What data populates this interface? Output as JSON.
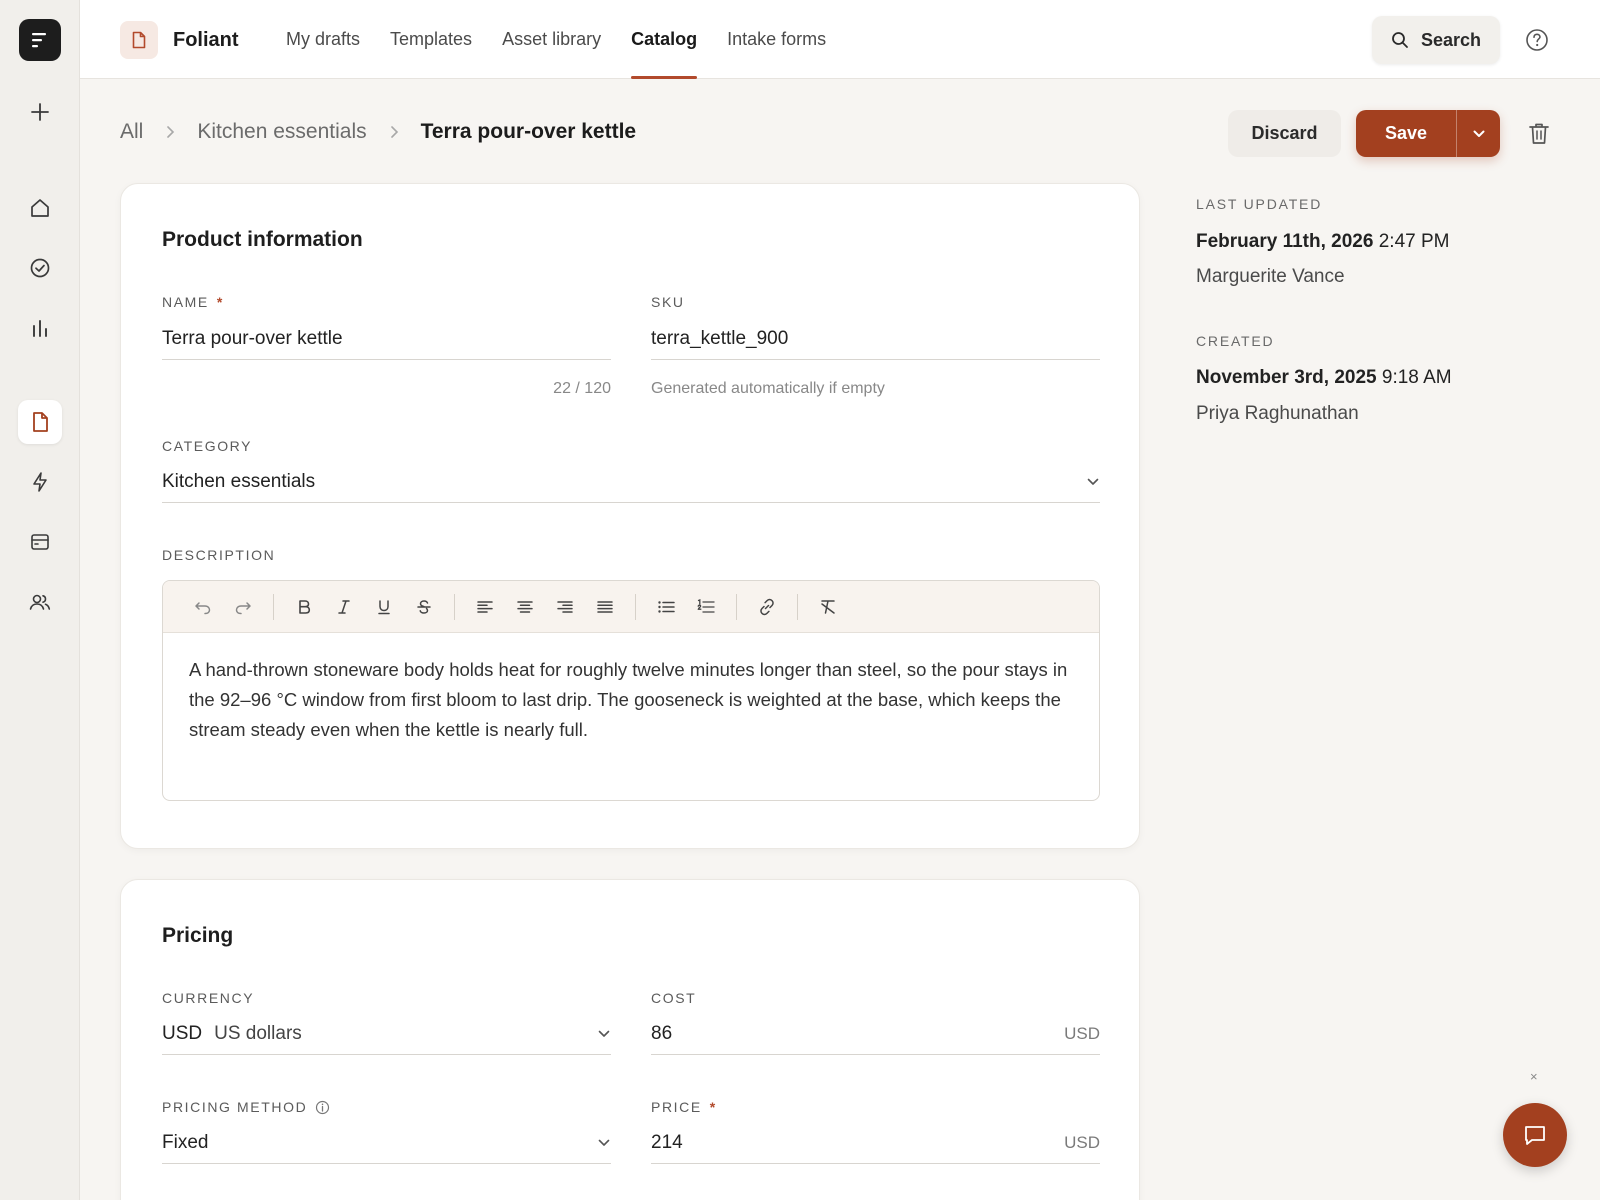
{
  "app": {
    "brand": "Foliant"
  },
  "nav": {
    "tabs": [
      {
        "label": "My drafts"
      },
      {
        "label": "Templates"
      },
      {
        "label": "Asset library"
      },
      {
        "label": "Catalog"
      },
      {
        "label": "Intake forms"
      }
    ],
    "active": "Catalog",
    "search_label": "Search"
  },
  "breadcrumb": {
    "items": [
      "All",
      "Kitchen essentials"
    ],
    "current": "Terra pour-over kettle"
  },
  "actions": {
    "discard": "Discard",
    "save": "Save"
  },
  "product_info": {
    "title": "Product information",
    "name": {
      "label": "NAME",
      "required": "*",
      "value": "Terra pour-over kettle",
      "counter": "22 / 120"
    },
    "sku": {
      "label": "SKU",
      "value": "terra_kettle_900",
      "hint": "Generated automatically if empty"
    },
    "category": {
      "label": "CATEGORY",
      "value": "Kitchen essentials"
    },
    "description": {
      "label": "DESCRIPTION",
      "text": "A hand-thrown stoneware body holds heat for roughly twelve minutes longer than steel, so the pour stays in the 92–96 °C window from first bloom to last drip. The gooseneck is weighted at the base, which keeps the stream steady even when the kettle is nearly full."
    }
  },
  "pricing": {
    "title": "Pricing",
    "currency": {
      "label": "CURRENCY",
      "code": "USD",
      "name": "US dollars"
    },
    "cost": {
      "label": "COST",
      "value": "86",
      "unit": "USD"
    },
    "method": {
      "label": "PRICING METHOD",
      "value": "Fixed"
    },
    "price": {
      "label": "PRICE",
      "required": "*",
      "value": "214",
      "unit": "USD"
    }
  },
  "meta": {
    "updated": {
      "label": "LAST UPDATED",
      "date": "February 11th, 2026",
      "time": "2:47 PM",
      "by": "Marguerite Vance"
    },
    "created": {
      "label": "CREATED",
      "date": "November 3rd, 2025",
      "time": "9:18 AM",
      "by": "Priya Raghunathan"
    }
  },
  "chat": {
    "close": "×"
  },
  "colors": {
    "accent": "#a3401f",
    "active_tab_underline": "#b24a2c"
  }
}
